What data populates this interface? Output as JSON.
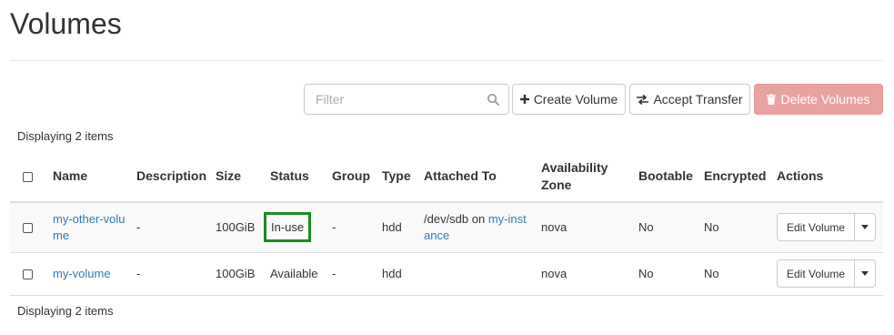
{
  "page": {
    "title": "Volumes"
  },
  "toolbar": {
    "filter_placeholder": "Filter",
    "create_label": "Create Volume",
    "transfer_label": "Accept Transfer",
    "delete_label": "Delete Volumes",
    "delete_color": "#e8a3a0"
  },
  "table": {
    "count_text": "Displaying 2 items",
    "headers": {
      "name": "Name",
      "description": "Description",
      "size": "Size",
      "status": "Status",
      "group": "Group",
      "type": "Type",
      "attached": "Attached To",
      "zone": "Availability Zone",
      "bootable": "Bootable",
      "encrypted": "Encrypted",
      "actions": "Actions"
    },
    "rows": [
      {
        "name": "my-other-volume",
        "description": "-",
        "size": "100GiB",
        "status": "In-use",
        "group": "-",
        "type": "hdd",
        "attached_prefix": "/dev/sdb on ",
        "attached_link": "my-instance",
        "zone": "nova",
        "bootable": "No",
        "encrypted": "No",
        "action": "Edit Volume"
      },
      {
        "name": "my-volume",
        "description": "-",
        "size": "100GiB",
        "status": "Available",
        "group": "-",
        "type": "hdd",
        "attached_prefix": "",
        "attached_link": "",
        "zone": "nova",
        "bootable": "No",
        "encrypted": "No",
        "action": "Edit Volume"
      }
    ]
  },
  "colors": {
    "link": "#337ab7",
    "highlight_border": "#1f8a1f"
  },
  "icons": [
    "search-icon",
    "plus-icon",
    "transfer-icon",
    "trash-icon",
    "caret-down-icon"
  ]
}
